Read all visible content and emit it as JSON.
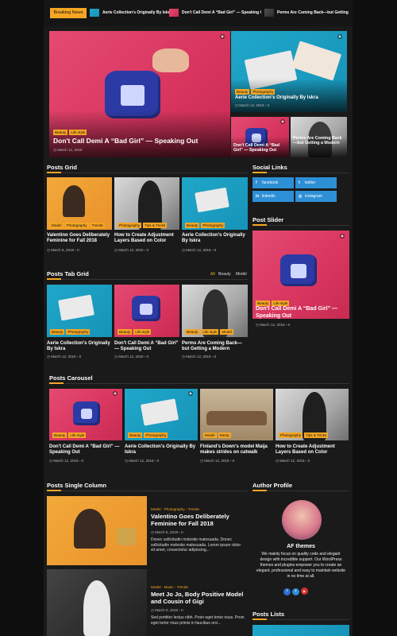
{
  "breaking": {
    "label": "Breaking News",
    "items": [
      "Aerie Collection's Originally By Iskra",
      "Don't Call Demi A “Bad Girl” — Speaking Out",
      "Perms Are Coming Back—but Getting a Modern"
    ]
  },
  "hero": {
    "main": {
      "tags": [
        "Beauty",
        "Life style"
      ],
      "title": "Don't Call Demi A “Bad Girl” — Speaking Out",
      "date": "March 12, 2018"
    },
    "side1": {
      "tags": [
        "Beauty",
        "Photography"
      ],
      "title": "Aerie Collection's Originally By Iskra",
      "date": "March 12, 2018",
      "comments": "0"
    },
    "side2": {
      "title": "Don't Call Demi A “Bad Girl” — Speaking Out"
    },
    "side3": {
      "title": "Perms Are Coming Back—but Getting a Modern"
    }
  },
  "posts_grid": {
    "heading": "Posts Grid",
    "items": [
      {
        "tags": [
          "Model",
          "Photography",
          "Trends"
        ],
        "title": "Valentino Goes Deliberately Feminine for Fall 2018",
        "date": "March 6, 2018",
        "comments": "0"
      },
      {
        "tags": [
          "Photography",
          "Tips & Tricks"
        ],
        "title": "How to Create Adjustment Layers Based on Color",
        "date": "March 12, 2018",
        "comments": "0"
      },
      {
        "tags": [
          "Beauty",
          "Photography"
        ],
        "title": "Aerie Collection's Originally By Iskra",
        "date": "March 12, 2018",
        "comments": "0"
      }
    ]
  },
  "social": {
    "heading": "Social Links",
    "links": [
      {
        "icon": "f",
        "label": "facebook"
      },
      {
        "icon": "t",
        "label": "twitter"
      },
      {
        "icon": "in",
        "label": "linkedin"
      },
      {
        "icon": "◎",
        "label": "instagram"
      }
    ]
  },
  "post_slider": {
    "heading": "Post Slider",
    "tags": [
      "Beauty",
      "Life style"
    ],
    "title": "Don't Call Demi A “Bad Girl” — Speaking Out",
    "date": "March 12, 2018",
    "comments": "0"
  },
  "tab_grid": {
    "heading": "Posts Tab Grid",
    "tabs": [
      "All",
      "Beauty",
      "Model"
    ],
    "items": [
      {
        "tags": [
          "Beauty",
          "Photography"
        ],
        "title": "Aerie Collection's Originally By Iskra",
        "date": "March 12, 2018",
        "comments": "0"
      },
      {
        "tags": [
          "Beauty",
          "Life style"
        ],
        "title": "Don't Call Demi A “Bad Girl” — Speaking Out",
        "date": "March 12, 2018",
        "comments": "0"
      },
      {
        "tags": [
          "Beauty",
          "Life style",
          "Model"
        ],
        "title": "Perms Are Coming Back—but Getting a Modern",
        "date": "March 12, 2018",
        "comments": "0"
      }
    ]
  },
  "carousel": {
    "heading": "Posts Carousel",
    "items": [
      {
        "tags": [
          "Beauty",
          "Life style"
        ],
        "title": "Don't Call Demi A “Bad Girl” — Speaking Out",
        "date": "March 12, 2018",
        "comments": "0"
      },
      {
        "tags": [
          "Beauty",
          "Photography"
        ],
        "title": "Aerie Collection's Originally By Iskra",
        "date": "March 12, 2018",
        "comments": "0"
      },
      {
        "tags": [
          "Model",
          "Ramp"
        ],
        "title": "Finland's Down's model Maija makes strides on catwalk",
        "date": "March 12, 2018",
        "comments": "0"
      },
      {
        "tags": [
          "Photography",
          "Tips & Tricks"
        ],
        "title": "How to Create Adjustment Layers Based on Color",
        "date": "March 12, 2018",
        "comments": "0"
      }
    ]
  },
  "single_column": {
    "heading": "Posts Single Column",
    "items": [
      {
        "cats": "Model - Photography - Trends",
        "title": "Valentino Goes Deliberately Feminine for Fall 2018",
        "date": "March 6, 2018",
        "comments": "0",
        "excerpt": "Donec sollicitudin molestie malesuada. Donec sollicitudin molestie malesuada. Lorem ipsum dolor sit amet, consectetur adipiscing..."
      },
      {
        "cats": "Model - Music - Trends",
        "title": "Meet Jo Jo, Body Positive Model and Cousin of Gigi",
        "date": "March 6, 2018",
        "comments": "0",
        "excerpt": "Sed porttitor lectus nibh. Proin eget tortor risus. Proin eget tortor risus primis in faucibus orci..."
      }
    ]
  },
  "author": {
    "heading": "Author Profile",
    "name": "AF themes",
    "bio": "We mainly focus on quality code and elegant design with incredible support. Our WordPress themes and plugins empower you to create an elegant, professional and easy to maintain website in no time at all.",
    "socials": [
      "f",
      "t",
      "▶"
    ]
  },
  "posts_lists": {
    "heading": "Posts Lists"
  },
  "colors": {
    "accent": "#f5a623",
    "bg": "#1a1a1a",
    "social": "#2d8fd6"
  }
}
